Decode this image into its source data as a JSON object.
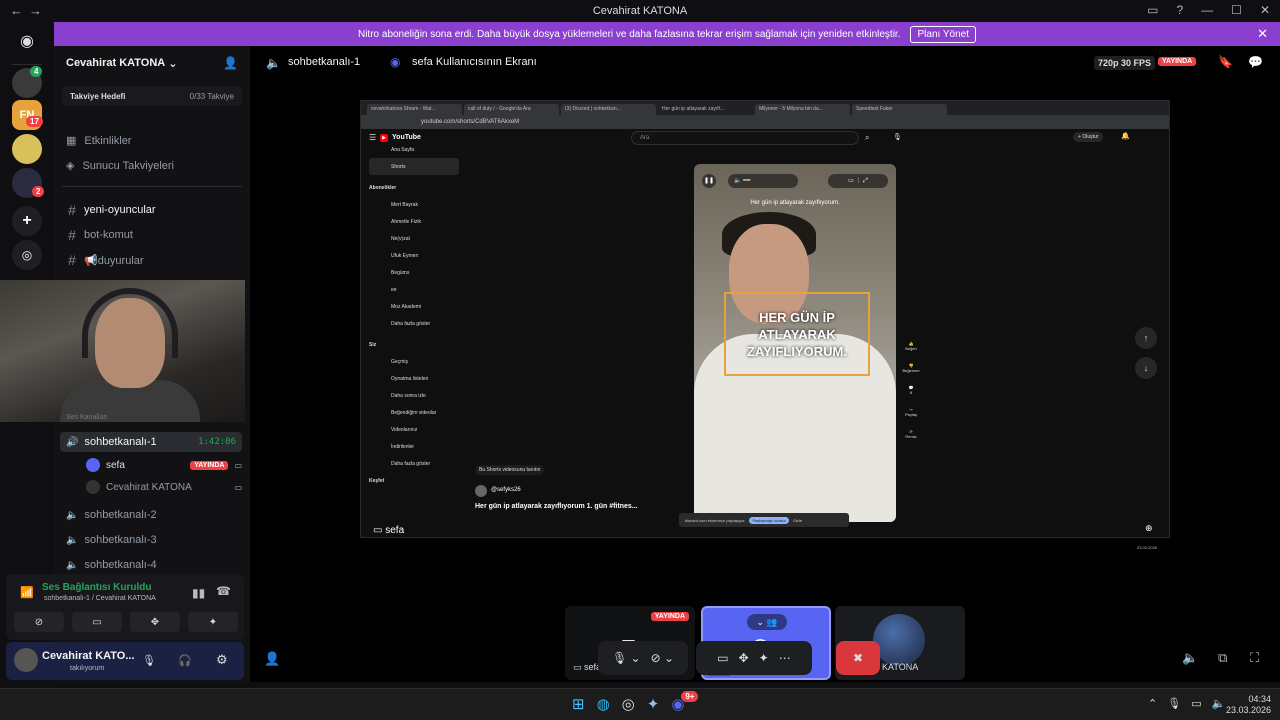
{
  "window": {
    "title": "Cevahirat KATONA",
    "controls": [
      "□",
      "?",
      "—",
      "☐",
      "✕"
    ]
  },
  "banner": {
    "text": "Nitro aboneliğin sona erdi. Daha büyük dosya yüklemeleri ve daha fazlasına tekrar erişim sağlamak için yeniden etkinleştir.",
    "button": "Planı Yönet",
    "bg": "#8b3fcf"
  },
  "servers": [
    {
      "badge": "4"
    },
    {
      "label": "FN",
      "badge": "17"
    },
    {
      "label": ""
    },
    {
      "badge": "2"
    }
  ],
  "sidebar": {
    "guild_name": "Cevahirat KATONA",
    "boost": {
      "label": "Takviye Hedefi",
      "progress": "0/33 Takviye"
    },
    "events": "Etkinlikler",
    "boosts": "Sunucu Takviyeleri",
    "channels": [
      "yeni-oyuncular",
      "bot-komut",
      "📢duyurular"
    ],
    "voice_header": "Ses Kanalları",
    "active_voice": {
      "name": "sohbetkanalı-1",
      "time": "1:42:06"
    },
    "voice_users": [
      {
        "name": "sefa",
        "live": "YAYINDA"
      },
      {
        "name": "Cevahirat KATONA"
      }
    ],
    "other_voice": [
      "sohbetkanalı-2",
      "sohbetkanalı-3",
      "sohbetkanalı-4"
    ]
  },
  "voice_panel": {
    "status": "Ses Bağlantısı Kuruldu",
    "channel": "sohbetkanalı-1 / Cevahirat KATONA",
    "status_color": "#23a55a"
  },
  "user_panel": {
    "name": "Cevahirat KATO...",
    "status": "takılıyorum"
  },
  "topbar": {
    "channel": "sohbetkanalı-1",
    "stream_title": "sefa Kullanıcısının Ekranı",
    "quality": "720p 30 FPS",
    "live": "YAYINDA"
  },
  "stream": {
    "owner_label": "sefa",
    "tabs": [
      "cevahirkatona Shram - Wat...",
      "call of duty / - Google'da Ara",
      "(3) Discord | sohbetkan...",
      "Her gün ip atlayarak zayıfl...",
      "Milyoner - 5 Milyona bin da...",
      "Speedtest Faker"
    ],
    "url": "youtube.com/shorts/CdBVAT6AkxeM",
    "yt_logo": "YouTube",
    "search_placeholder": "Ara",
    "create_label": "Oluştur",
    "nav": [
      "Ana Sayfa",
      "Shorts"
    ],
    "subs_header": "Abonelikler",
    "subs": [
      "Mert Bayrak",
      "Ahmetle Fizik",
      "Ne(v)zat",
      "Ufuk Eymen",
      "Begüms",
      "ee",
      "Moz Akademi",
      "Daha fazla göster"
    ],
    "you_header": "Siz",
    "you_items": [
      "Geçmiş",
      "Oynatma listeleri",
      "Daha sonra izle",
      "Beğendiğim videolar",
      "Videolarınız",
      "İndirilenler",
      "Daha fazla göster"
    ],
    "explore": "Keşfet",
    "short_caption_top": "Her gün ip atlayarak zayıflıyorum.",
    "short_overlay": "HER GÜN İP ATLAYARAK ZAYIFLIYORUM.",
    "short_channel": "@sefyks26",
    "short_title": "Her gün ip atlayarak zayıflıyorum 1. gün #fitnes...",
    "remix": "Bu Shorts videosunu tanıtın",
    "share_bar": "discord.com ekranınızı paylaşıyor.",
    "share_stop": "Paylaşmayı durdur",
    "share_hide": "Gizle",
    "actions": [
      "Beğen",
      "Beğenme",
      "8",
      "Paylaş",
      "Remix"
    ],
    "sys_date": "23.03.2026"
  },
  "tiles": [
    {
      "name": "sefa",
      "live": "YAYINDA"
    },
    {
      "name": "sefa"
    },
    {
      "name": "Cevahirat KATONA"
    }
  ],
  "taskbar": {
    "time": "04:34",
    "date": "23.03.2026",
    "badge": "9+"
  },
  "colors": {
    "accent": "#5865f2",
    "live": "#ed4245",
    "end_call": "#da373c"
  }
}
